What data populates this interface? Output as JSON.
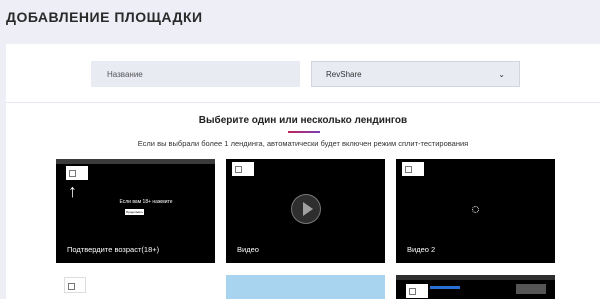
{
  "page_title": "ДОБАВЛЕНИЕ ПЛОЩАДКИ",
  "form": {
    "name_placeholder": "Название",
    "mode_selected": "RevShare"
  },
  "landings": {
    "heading": "Выберите один или несколько лендингов",
    "hint": "Если вы выбрали более 1 лендинга, автоматически будет включен режим сплит-тестирования",
    "cards": [
      {
        "label": "Подтвердите возраст(18+)",
        "overlay_text": "Если вам 18+ нажмите",
        "overlay_button": "Продолжить"
      },
      {
        "label": "Видео"
      },
      {
        "label": "Видео 2"
      }
    ]
  },
  "colors": {
    "background": "#edeef6",
    "accent_gradient_start": "#c0245c",
    "accent_gradient_end": "#7a3fb0"
  },
  "icons": [
    "chevron-down-icon",
    "play-icon",
    "arrow-up-icon",
    "loading-spinner-icon",
    "checkbox-icon"
  ]
}
